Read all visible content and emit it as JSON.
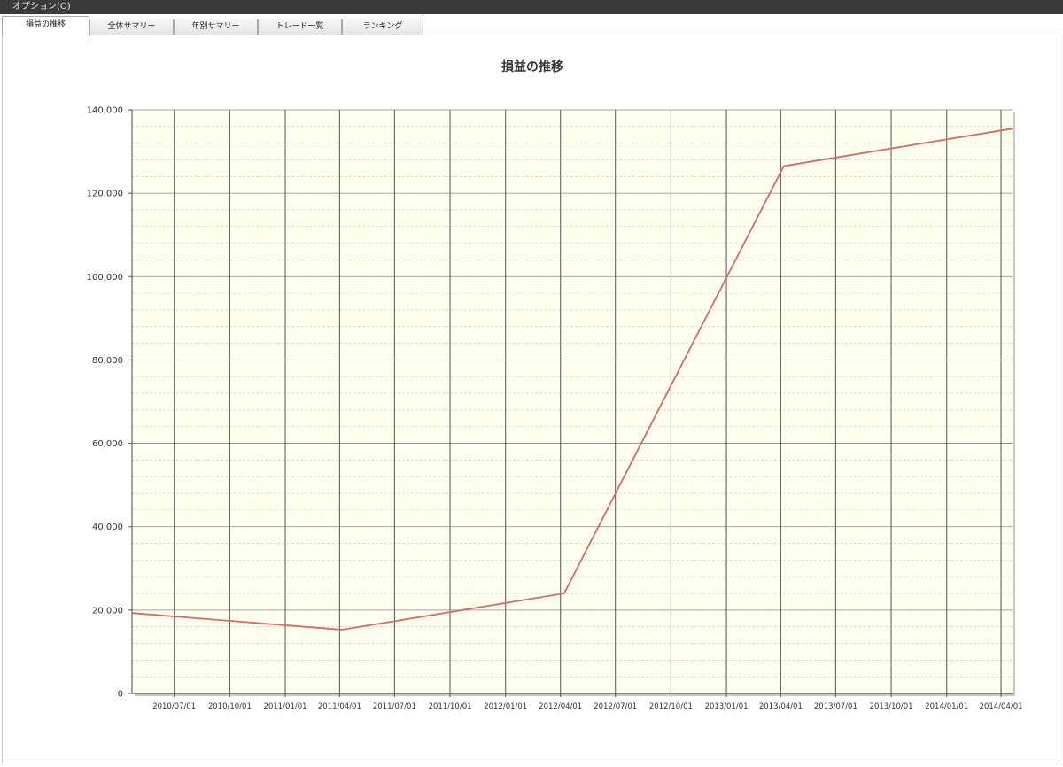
{
  "menu": {
    "options_label": "オプション(O)"
  },
  "tabs": [
    {
      "label": "損益の推移",
      "active": true
    },
    {
      "label": "全体サマリー",
      "active": false
    },
    {
      "label": "年別サマリー",
      "active": false
    },
    {
      "label": "トレード一覧",
      "active": false
    },
    {
      "label": "ランキング",
      "active": false
    }
  ],
  "colors": {
    "plot_background": "#fffff0",
    "line": "#d46a6a",
    "menubar": "#3a3a3a"
  },
  "chart_data": {
    "type": "line",
    "title": "損益の推移",
    "xlabel": "",
    "ylabel": "",
    "ylim": [
      0,
      140000
    ],
    "xlim": [
      "2010-04-22",
      "2014-04-20"
    ],
    "y_ticks": [
      0,
      20000,
      40000,
      60000,
      80000,
      100000,
      120000,
      140000
    ],
    "y_tick_labels": [
      "0",
      "20,000",
      "40,000",
      "60,000",
      "80,000",
      "100,000",
      "120,000",
      "140,000"
    ],
    "x_ticks": [
      "2010-07-01",
      "2010-10-01",
      "2011-01-01",
      "2011-04-01",
      "2011-07-01",
      "2011-10-01",
      "2012-01-01",
      "2012-04-01",
      "2012-07-01",
      "2012-10-01",
      "2013-01-01",
      "2013-04-01",
      "2013-07-01",
      "2013-10-01",
      "2014-01-01",
      "2014-04-01"
    ],
    "x_tick_labels": [
      "2010/07/01",
      "2010/10/01",
      "2011/01/01",
      "2011/04/01",
      "2011/07/01",
      "2011/10/01",
      "2012/01/01",
      "2012/04/01",
      "2012/07/01",
      "2012/10/01",
      "2013/01/01",
      "2013/04/01",
      "2013/07/01",
      "2013/10/01",
      "2014/01/01",
      "2014/04/01"
    ],
    "grid": true,
    "series": [
      {
        "points": [
          {
            "x": "2010-04-22",
            "y": 19300
          },
          {
            "x": "2011-04-05",
            "y": 15300
          },
          {
            "x": "2012-04-07",
            "y": 24000
          },
          {
            "x": "2013-04-06",
            "y": 126500
          },
          {
            "x": "2014-04-20",
            "y": 135500
          }
        ]
      }
    ]
  }
}
